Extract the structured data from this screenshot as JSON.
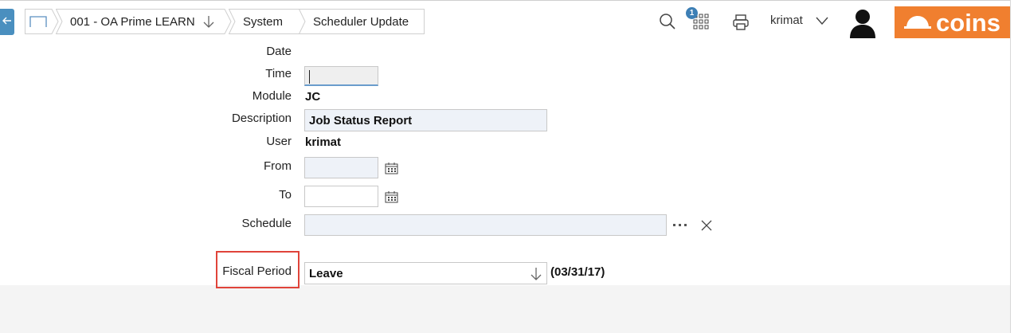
{
  "header": {
    "breadcrumbs": [
      {
        "label": "",
        "icon": "home-icon"
      },
      {
        "label": "001 - OA Prime LEARN",
        "has_dropdown": true
      },
      {
        "label": "System"
      },
      {
        "label": "Scheduler Update"
      }
    ],
    "notification_count": "1",
    "user": "krimat",
    "logo_text": "coins"
  },
  "form": {
    "date_label": "Date",
    "time_label": "Time",
    "time_value": "",
    "module_label": "Module",
    "module_value": "JC",
    "description_label": "Description",
    "description_value": "Job Status Report",
    "user_label": "User",
    "user_value": "krimat",
    "from_label": "From",
    "from_value": "",
    "to_label": "To",
    "to_value": "",
    "schedule_label": "Schedule",
    "schedule_value": "",
    "fiscal_label": "Fiscal Period",
    "fiscal_value": "Leave",
    "fiscal_date": "(03/31/17)"
  },
  "colors": {
    "accent": "#4a8fbf",
    "logo": "#f07f2f",
    "highlight_box": "#e0443a",
    "field_tint": "#eef2f8"
  }
}
